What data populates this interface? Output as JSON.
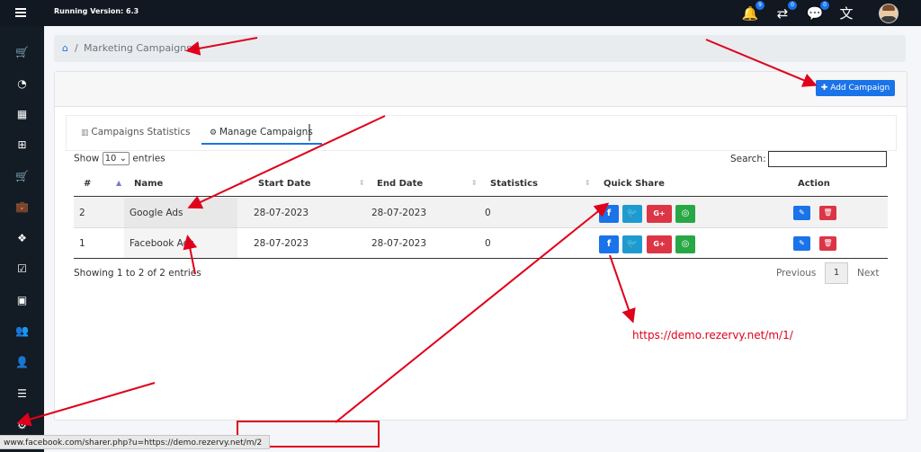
{
  "topbar": {
    "title": "Running Version: 6.3",
    "notifications_badge": "9",
    "transfers_badge": "0",
    "chat_badge": "0"
  },
  "sidebar": {
    "items": [
      {
        "icon": "cart-icon"
      },
      {
        "icon": "dashboard-icon"
      },
      {
        "icon": "calendar-icon"
      },
      {
        "icon": "calendar-plus-icon"
      },
      {
        "icon": "shopping-cart-icon"
      },
      {
        "icon": "briefcase-icon"
      },
      {
        "icon": "cubes-icon"
      },
      {
        "icon": "calendar-check-icon"
      },
      {
        "icon": "money-icon"
      },
      {
        "icon": "users-icon"
      },
      {
        "icon": "user-icon"
      },
      {
        "icon": "list-icon"
      },
      {
        "icon": "cogs-icon"
      }
    ]
  },
  "breadcrumb": {
    "separator": "/",
    "current": "Marketing Campaigns"
  },
  "header": {
    "add_button": "✚ Add Campaign"
  },
  "tabs": {
    "stats": "Campaigns Statistics",
    "manage": "Manage Campaigns"
  },
  "table": {
    "show_label": "Show",
    "entries_select": "10",
    "entries_label": "entries",
    "search_label": "Search:",
    "columns": [
      "#",
      "Name",
      "Start Date",
      "End Date",
      "Statistics",
      "Quick Share",
      "Action"
    ],
    "rows": [
      {
        "num": "2",
        "name": "Google Ads",
        "start": "28-07-2023",
        "end": "28-07-2023",
        "stats": "0"
      },
      {
        "num": "1",
        "name": "Facebook Ads",
        "start": "28-07-2023",
        "end": "28-07-2023",
        "stats": "0"
      }
    ],
    "share_labels": {
      "fb": "f",
      "tw": "🐦",
      "gp": "G+",
      "wa": "◎"
    },
    "info": "Showing 1 to 2 of 2 entries",
    "previous": "Previous",
    "page": "1",
    "next": "Next"
  },
  "annotation": {
    "url": "https://demo.rezervy.net/m/1/"
  },
  "statusbar": {
    "text": "www.facebook.com/sharer.php?u=https://demo.rezervy.net/m/2"
  },
  "colors": {
    "primary": "#1a73e8",
    "danger": "#dc3545",
    "success": "#28a745",
    "twitter": "#1d9bd1",
    "topbar": "#111821",
    "annotation": "#e0001b"
  }
}
